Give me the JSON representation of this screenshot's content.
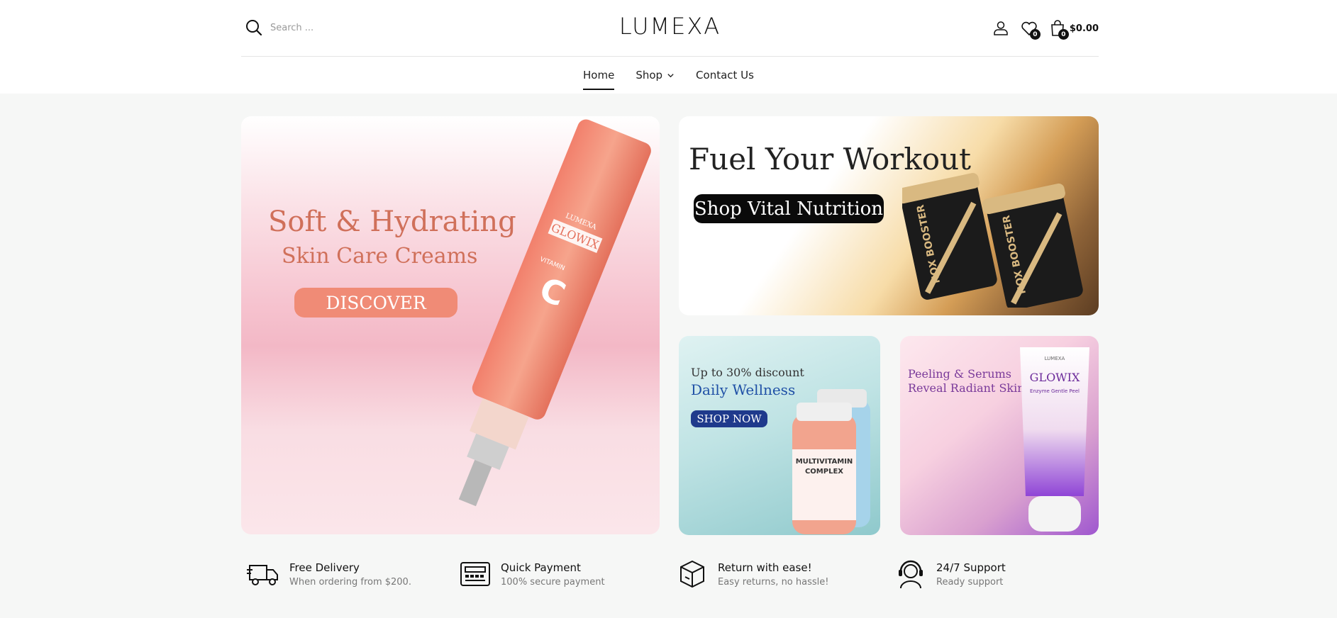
{
  "header": {
    "search_placeholder": "Search ...",
    "logo": "LUMEXA",
    "wishlist_count": "0",
    "cart_count": "0",
    "cart_total": "$0.00"
  },
  "nav": {
    "items": [
      {
        "label": "Home",
        "active": true
      },
      {
        "label": "Shop",
        "has_dropdown": true
      },
      {
        "label": "Contact Us"
      }
    ]
  },
  "banners": {
    "main": {
      "title_line1": "Soft & Hydrating",
      "title_line2": "Skin Care Creams",
      "cta": "DISCOVER",
      "product_brand": "LUMEXA",
      "product_name": "GLOWIX",
      "product_vitamin": "VITAMIN",
      "product_letter": "C"
    },
    "workout": {
      "title": "Fuel Your Workout",
      "cta": "Shop Vital Nutrition",
      "product_label": "NOX BOOSTER"
    },
    "wellness": {
      "discount": "Up to 30% discount",
      "title": "Daily Wellness",
      "cta": "SHOP NOW",
      "product_label1": "MULTIVITAMIN",
      "product_label2": "COMPLEX"
    },
    "peel": {
      "line1": "Peeling & Serums",
      "line2": "Reveal Radiant Skin",
      "product_brand": "LUMEXA",
      "product_name": "GLOWIX",
      "product_desc": "Enzyme Gentle Peel"
    }
  },
  "features": [
    {
      "title": "Free Delivery",
      "subtitle": "When ordering from $200.",
      "icon": "delivery-truck-icon"
    },
    {
      "title": "Quick Payment",
      "subtitle": "100% secure payment",
      "icon": "credit-card-icon"
    },
    {
      "title": "Return with ease!",
      "subtitle": "Easy returns, no hassle!",
      "icon": "return-box-icon"
    },
    {
      "title": "24/7 Support",
      "subtitle": "Ready support",
      "icon": "headset-support-icon"
    }
  ],
  "colors": {
    "accent_coral": "#f08b76",
    "navy": "#1f3a8c",
    "purple": "#7a3a9a"
  }
}
